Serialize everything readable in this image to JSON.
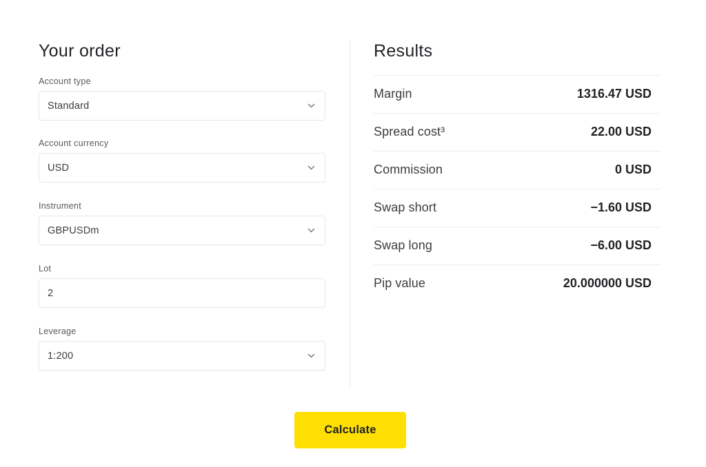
{
  "order": {
    "title": "Your order",
    "fields": [
      {
        "label": "Account type",
        "type": "select",
        "value": "Standard"
      },
      {
        "label": "Account currency",
        "type": "select",
        "value": "USD"
      },
      {
        "label": "Instrument",
        "type": "select",
        "value": "GBPUSDm"
      },
      {
        "label": "Lot",
        "type": "input",
        "value": "2"
      },
      {
        "label": "Leverage",
        "type": "select",
        "value": "1:200"
      }
    ],
    "chevron_icon": "chevron-down-icon"
  },
  "results": {
    "title": "Results",
    "rows": [
      {
        "label": "Margin",
        "value": "1316.47 USD"
      },
      {
        "label": "Spread cost³",
        "value": "22.00 USD"
      },
      {
        "label": "Commission",
        "value": "0 USD"
      },
      {
        "label": "Swap short",
        "value": "−1.60 USD"
      },
      {
        "label": "Swap long",
        "value": "−6.00 USD"
      },
      {
        "label": "Pip value",
        "value": "20.000000 USD"
      }
    ]
  },
  "actions": {
    "calculate_label": "Calculate"
  },
  "colors": {
    "accent": "#ffde02",
    "text": "#1f2124",
    "border": "#e7e8ea"
  }
}
